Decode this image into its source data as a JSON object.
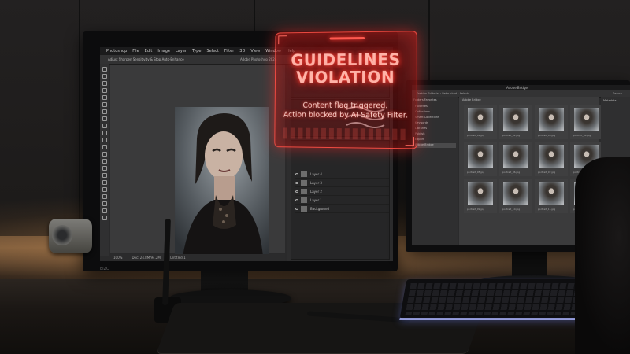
{
  "overlay": {
    "title_line1": "GUIDELINES",
    "title_line2": "VIOLATION",
    "message_line1": "Content flag triggered.",
    "message_line2": "Action blocked by AI Safety Filter."
  },
  "left_monitor": {
    "brand": "EIZO",
    "app": {
      "menu": [
        "Photoshop",
        "File",
        "Edit",
        "Image",
        "Layer",
        "Type",
        "Select",
        "Filter",
        "3D",
        "View",
        "Window",
        "Help"
      ],
      "option_hint": "Adjust Sharpen Sensitivity & Stop Auto-Enhance",
      "document_title": "Adobe Photoshop 2024",
      "status": [
        "100%",
        "Doc: 24.8M/94.2M",
        "Untitled-1"
      ]
    },
    "layers": [
      {
        "name": "Layer 4"
      },
      {
        "name": "Layer 3"
      },
      {
        "name": "Layer 2"
      },
      {
        "name": "Layer 1"
      },
      {
        "name": "Background"
      }
    ]
  },
  "right_monitor": {
    "app": {
      "window_title": "Adobe Bridge",
      "path": "Fashion Editorial › Retouched › Selects",
      "search": "Search",
      "content_header": "Adobe Bridge",
      "side_tabs": "Folders   Favorites",
      "side_items": [
        "Favorites",
        "Collections",
        "Smart Collections",
        "Keywords",
        "Libraries",
        "Publish",
        "Export",
        "Adobe Bridge"
      ],
      "selected_side_item": "Adobe Bridge",
      "right_panel_label": "Metadata"
    },
    "thumbnails": [
      {
        "caption": "portrait_01.jpg"
      },
      {
        "caption": "portrait_02.jpg"
      },
      {
        "caption": "portrait_03.jpg"
      },
      {
        "caption": "portrait_04.jpg"
      },
      {
        "caption": "portrait_05.jpg"
      },
      {
        "caption": "portrait_06.jpg"
      },
      {
        "caption": "portrait_07.jpg"
      },
      {
        "caption": "portrait_08.jpg"
      },
      {
        "caption": "portrait_09.jpg"
      },
      {
        "caption": "portrait_10.jpg"
      },
      {
        "caption": "portrait_11.jpg"
      },
      {
        "caption": "portrait_12.jpg"
      }
    ]
  },
  "colors": {
    "overlay_red": "#ff3b30",
    "keyboard_backlight": "#aeb7ff",
    "ui_dark": "#2b2b2c"
  }
}
